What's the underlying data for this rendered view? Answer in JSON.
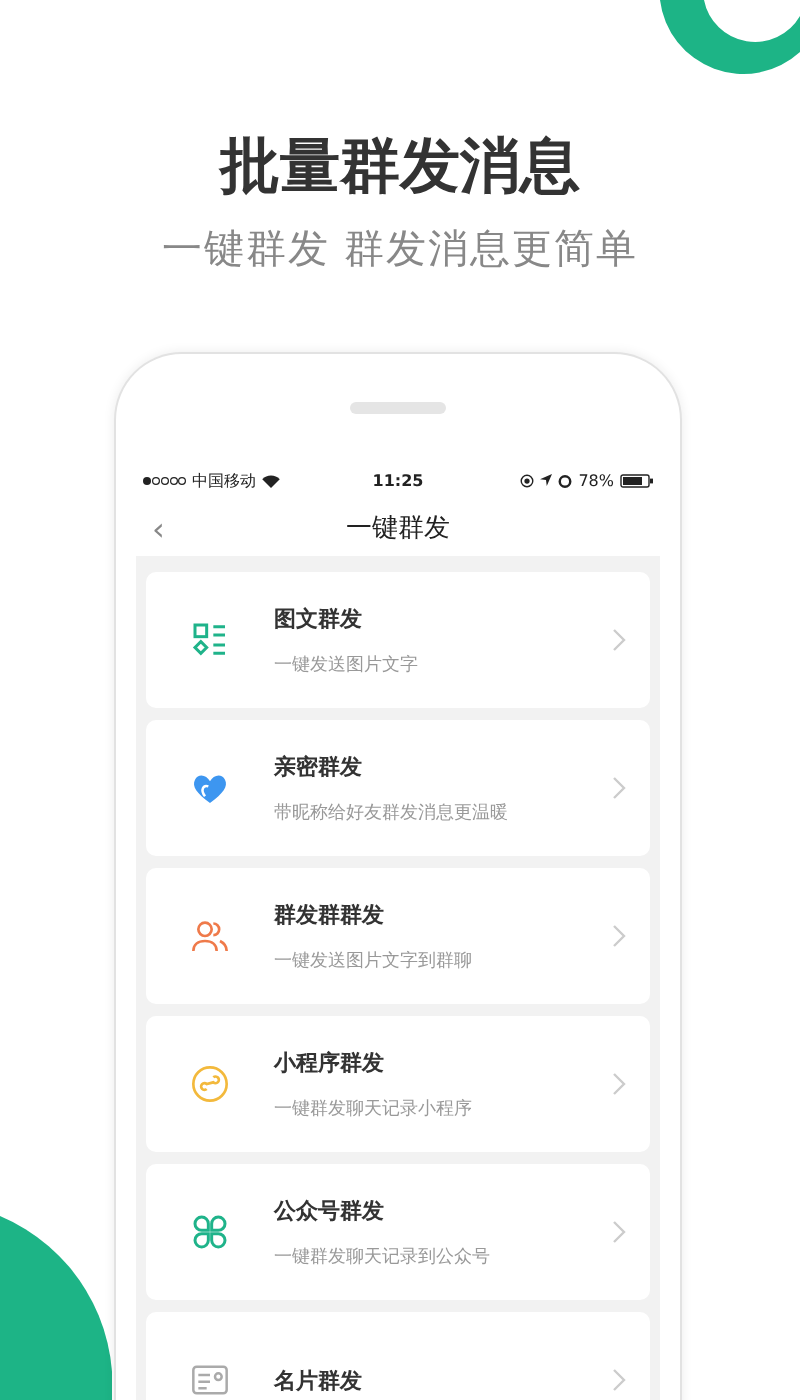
{
  "headline": "批量群发消息",
  "tagline": "一键群发 群发消息更简单",
  "status_bar": {
    "carrier": "中国移动",
    "time": "11:25",
    "battery": "78%"
  },
  "nav": {
    "back": "‹",
    "title": "一键群发"
  },
  "items": [
    {
      "kind": "grid",
      "title": "图文群发",
      "subtitle": "一键发送图片文字"
    },
    {
      "kind": "heart",
      "title": "亲密群发",
      "subtitle": "带昵称给好友群发消息更温暖"
    },
    {
      "kind": "people",
      "title": "群发群群发",
      "subtitle": "一键发送图片文字到群聊"
    },
    {
      "kind": "link",
      "title": "小程序群发",
      "subtitle": "一键群发聊天记录小程序"
    },
    {
      "kind": "clover",
      "title": "公众号群发",
      "subtitle": "一键群发聊天记录到公众号"
    },
    {
      "kind": "card",
      "title": "名片群发"
    }
  ]
}
